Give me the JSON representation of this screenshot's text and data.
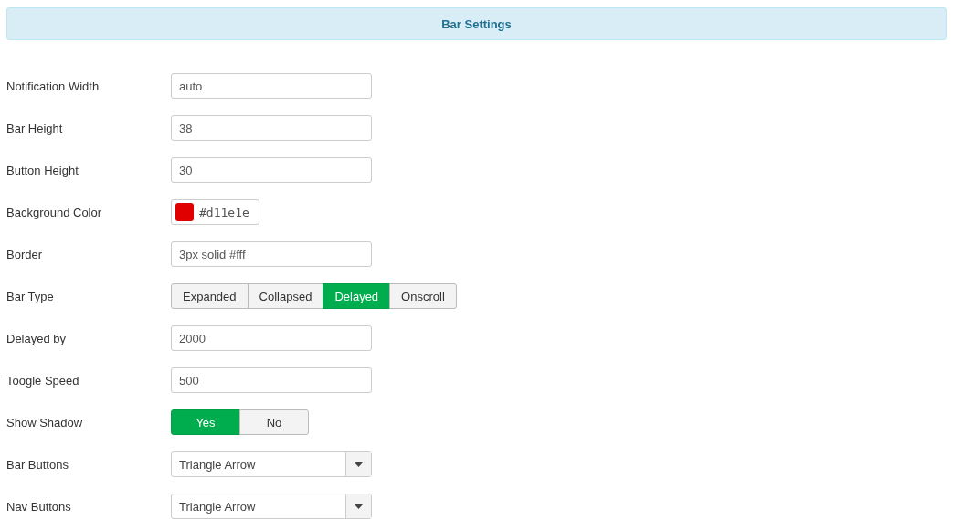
{
  "header": {
    "title": "Bar Settings"
  },
  "fields": [
    {
      "kind": "text",
      "label": "Notification Width",
      "value": "auto"
    },
    {
      "kind": "text",
      "label": "Bar Height",
      "value": "38"
    },
    {
      "kind": "text",
      "label": "Button Height",
      "value": "30"
    },
    {
      "kind": "color",
      "label": "Background Color",
      "value": "#d11e1e",
      "color": "#e00000"
    },
    {
      "kind": "text",
      "label": "Border",
      "value": "3px solid #fff"
    },
    {
      "kind": "segmented",
      "label": "Bar Type",
      "options": [
        {
          "label": "Expanded",
          "selected": false
        },
        {
          "label": "Collapsed",
          "selected": false
        },
        {
          "label": "Delayed",
          "selected": true
        },
        {
          "label": "Onscroll",
          "selected": false
        }
      ]
    },
    {
      "kind": "text",
      "label": "Delayed by",
      "value": "2000"
    },
    {
      "kind": "text",
      "label": "Toogle Speed",
      "value": "500"
    },
    {
      "kind": "segmented",
      "label": "Show Shadow",
      "options": [
        {
          "label": "Yes",
          "selected": true
        },
        {
          "label": "No",
          "selected": false
        }
      ]
    },
    {
      "kind": "select",
      "label": "Bar Buttons",
      "value": "Triangle Arrow"
    },
    {
      "kind": "select",
      "label": "Nav Buttons",
      "value": "Triangle Arrow"
    }
  ]
}
